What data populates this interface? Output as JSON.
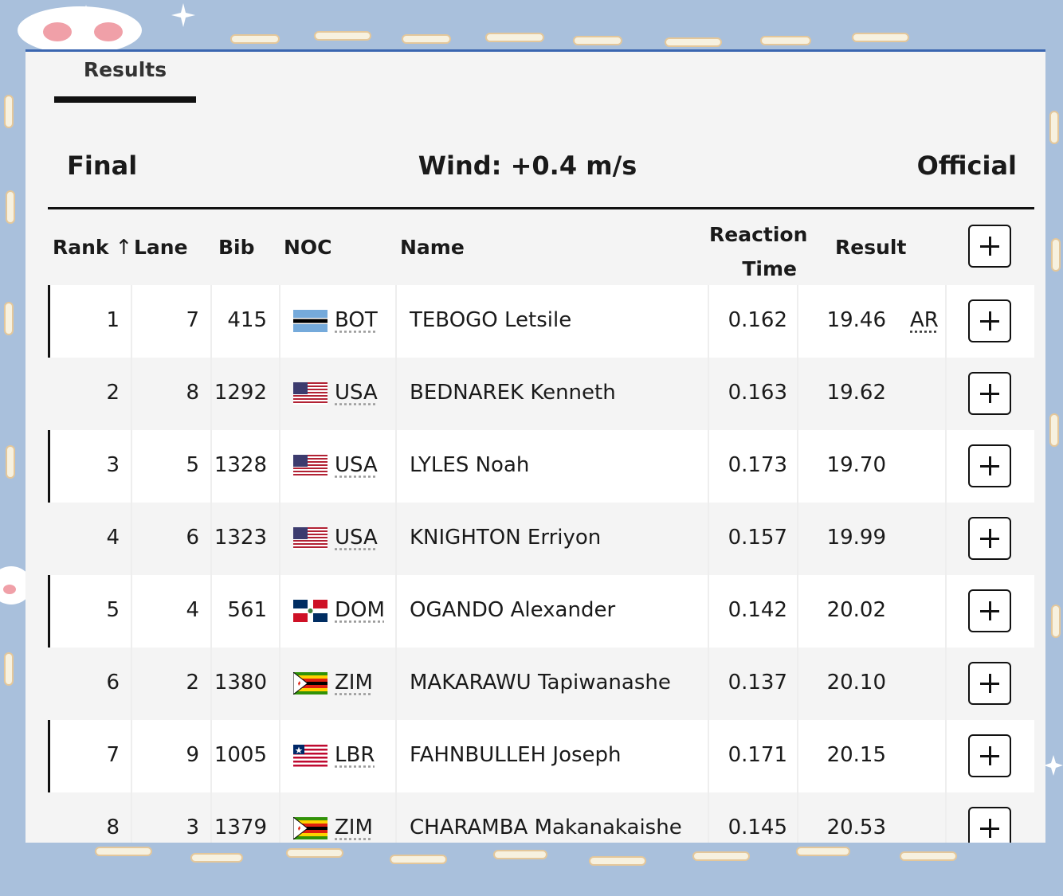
{
  "tabs": {
    "active_label": "Results"
  },
  "heat": {
    "title": "Final",
    "wind": "Wind: +0.4 m/s",
    "status": "Official"
  },
  "columns": {
    "rank": "Rank",
    "lane": "Lane",
    "bib": "Bib",
    "noc": "NOC",
    "name": "Name",
    "reaction_line1": "Reaction",
    "reaction_line2": "Time",
    "result": "Result",
    "sort_icon": "sort-ascending-icon"
  },
  "rows": [
    {
      "rank": "1",
      "lane": "7",
      "bib": "415",
      "noc": "BOT",
      "flag": "botswana-flag-icon",
      "name": "TEBOGO Letsile",
      "reaction": "0.162",
      "result": "19.46",
      "record": "AR"
    },
    {
      "rank": "2",
      "lane": "8",
      "bib": "1292",
      "noc": "USA",
      "flag": "usa-flag-icon",
      "name": "BEDNAREK Kenneth",
      "reaction": "0.163",
      "result": "19.62",
      "record": ""
    },
    {
      "rank": "3",
      "lane": "5",
      "bib": "1328",
      "noc": "USA",
      "flag": "usa-flag-icon",
      "name": "LYLES Noah",
      "reaction": "0.173",
      "result": "19.70",
      "record": ""
    },
    {
      "rank": "4",
      "lane": "6",
      "bib": "1323",
      "noc": "USA",
      "flag": "usa-flag-icon",
      "name": "KNIGHTON Erriyon",
      "reaction": "0.157",
      "result": "19.99",
      "record": ""
    },
    {
      "rank": "5",
      "lane": "4",
      "bib": "561",
      "noc": "DOM",
      "flag": "dominican-republic-flag-icon",
      "name": "OGANDO Alexander",
      "reaction": "0.142",
      "result": "20.02",
      "record": ""
    },
    {
      "rank": "6",
      "lane": "2",
      "bib": "1380",
      "noc": "ZIM",
      "flag": "zimbabwe-flag-icon",
      "name": "MAKARAWU Tapiwanashe",
      "reaction": "0.137",
      "result": "20.10",
      "record": ""
    },
    {
      "rank": "7",
      "lane": "9",
      "bib": "1005",
      "noc": "LBR",
      "flag": "liberia-flag-icon",
      "name": "FAHNBULLEH Joseph",
      "reaction": "0.171",
      "result": "20.15",
      "record": ""
    },
    {
      "rank": "8",
      "lane": "3",
      "bib": "1379",
      "noc": "ZIM",
      "flag": "zimbabwe-flag-icon",
      "name": "CHARAMBA Makanakaishe",
      "reaction": "0.145",
      "result": "20.53",
      "record": ""
    }
  ],
  "icons": {
    "expand": "plus-icon"
  },
  "colors": {
    "background": "#a9c0dc",
    "panel": "#f4f4f4",
    "accent": "#3a66b0",
    "text": "#1a1a1a"
  }
}
